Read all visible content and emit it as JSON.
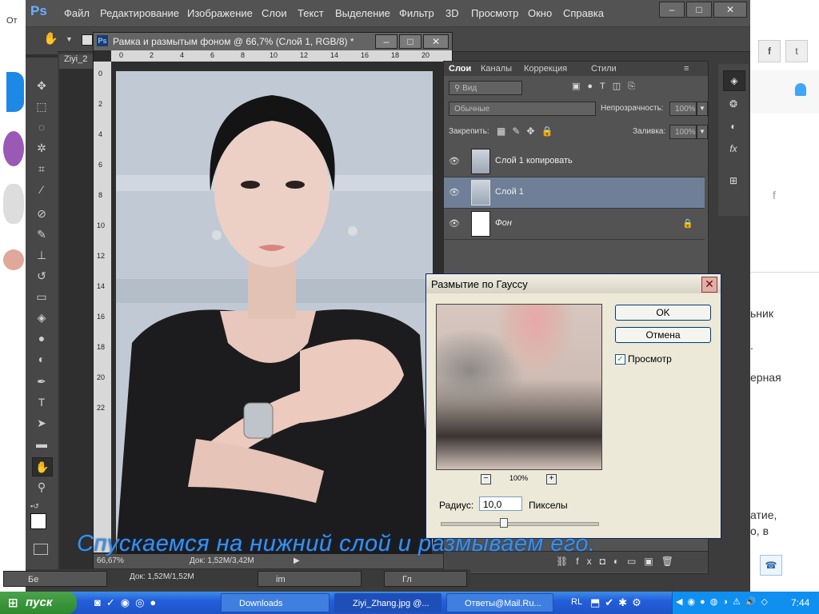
{
  "photoshop": {
    "logo": "Ps",
    "menu": [
      "Файл",
      "Редактирование",
      "Изображение",
      "Слои",
      "Текст",
      "Выделение",
      "Фильтр",
      "3D",
      "Просмотр",
      "Окно",
      "Справка"
    ],
    "window_buttons": [
      "–",
      "□",
      "✕"
    ],
    "side_doc_tab": "Ziyi_2",
    "document": {
      "title": "Рамка и размытым фоном @ 66,7% (Слой 1, RGB/8) *",
      "zoom": "66,67%",
      "doc_size": "Док: 1,52М/3,42М",
      "ruler_h": [
        "0",
        "2",
        "4",
        "6",
        "8",
        "10",
        "12",
        "14",
        "16",
        "18",
        "20"
      ],
      "ruler_v": [
        "0",
        "2",
        "4",
        "6",
        "8",
        "10",
        "12",
        "14",
        "16",
        "18",
        "20",
        "22"
      ]
    },
    "minimized_doc_status": "Док: 1,52М/1,52М",
    "minimized_tabs": [
      "Бе",
      "im",
      "Гл"
    ]
  },
  "layers_panel": {
    "tabs": [
      "Слои",
      "Каналы",
      "Коррекция",
      "Стили"
    ],
    "search_placeholder": "Вид",
    "blend_mode": "Обычные",
    "opacity_label": "Непрозрачность:",
    "opacity_value": "100%",
    "lock_label": "Закрепить:",
    "fill_label": "Заливка:",
    "fill_value": "100%",
    "layers": [
      {
        "name": "Слой 1 копировать",
        "selected": false
      },
      {
        "name": "Слой 1",
        "selected": true
      },
      {
        "name": "Фон",
        "selected": false,
        "locked": true
      }
    ]
  },
  "dialog": {
    "title": "Размытие по Гауссу",
    "ok": "OK",
    "cancel": "Отмена",
    "preview_label": "Просмотр",
    "preview_checked": true,
    "zoom": "100%",
    "radius_label": "Радиус:",
    "radius_value": "10,0",
    "radius_unit": "Пикселы"
  },
  "caption": "Спускаемся на нижний слой и размываем его.",
  "background_page": {
    "left_tab": "От",
    "right_snippets": [
      "ьник",
      ".",
      "ерная",
      "атие,",
      "о, в"
    ]
  },
  "taskbar": {
    "start": "пуск",
    "tasks": [
      "Downloads",
      "Ziyi_Zhang.jpg @...",
      "Ответы@Mail.Ru..."
    ],
    "lang": "RL",
    "time": "7:44"
  }
}
